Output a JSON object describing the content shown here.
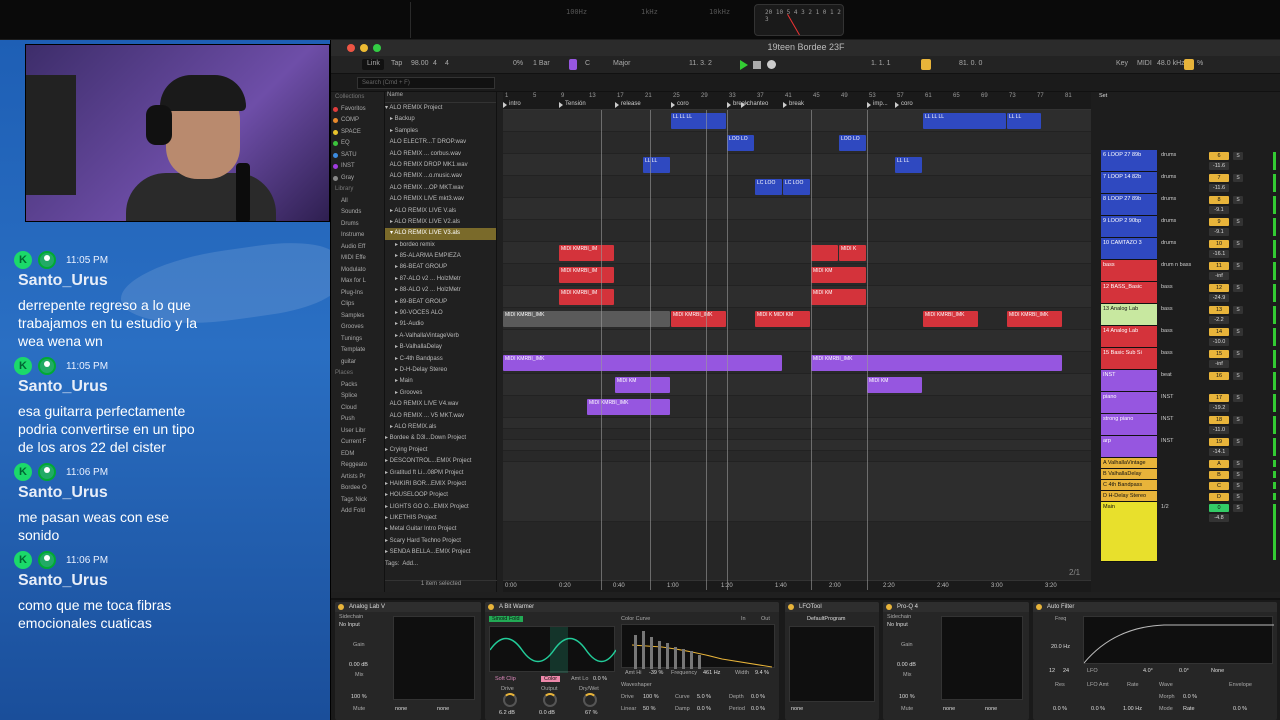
{
  "top": {
    "spectrum_labels": [
      "100Hz",
      "1kHz",
      "10kHz"
    ],
    "vu_scale": "20 10 5 4 3 2 1 0 1 2 3"
  },
  "stream": {
    "messages": [
      {
        "time": "11:05 PM",
        "user": "Santo_Urus",
        "text": "derrepente regreso a lo que trabajamos en tu estudio y la wea wena wn"
      },
      {
        "time": "11:05 PM",
        "user": "Santo_Urus",
        "text": "esa guitarra perfectamente podria convertirse en un tipo de los aros 22 del cister"
      },
      {
        "time": "11:06 PM",
        "user": "Santo_Urus",
        "text": "me pasan weas con ese sonido"
      },
      {
        "time": "11:06 PM",
        "user": "Santo_Urus",
        "text": "como que me toca fibras emocionales cuaticas"
      }
    ]
  },
  "ableton": {
    "title": "19teen Bordee 23F",
    "transport": {
      "link": "Link",
      "tap": "Tap",
      "bpm": "98.00",
      "sig_num": "4",
      "sig_den": "4",
      "cpu": "0%",
      "quant": "1 Bar",
      "key": "C",
      "scale": "Major",
      "position": "11.   3.   2",
      "loop_start": "1.   1.   1",
      "loop_len": "81.   0.   0",
      "key_btn": "Key",
      "midi_btn": "MIDI",
      "sample_rate": "48.0 kHz",
      "zoom": "%"
    },
    "search_placeholder": "Search (Cmd + F)",
    "browser": {
      "categories": [
        {
          "label": "Collections",
          "header": true
        },
        {
          "label": "Favoritos",
          "color": "#e03c3c"
        },
        {
          "label": "COMP",
          "color": "#e88a2c"
        },
        {
          "label": "SPACE",
          "color": "#e8c42c"
        },
        {
          "label": "EQ",
          "color": "#3cc43c"
        },
        {
          "label": "SATU",
          "color": "#3c8ce0"
        },
        {
          "label": "INST",
          "color": "#a03ce0"
        },
        {
          "label": "Gray",
          "color": "#888888"
        },
        {
          "label": "Library",
          "header": true
        },
        {
          "label": "All"
        },
        {
          "label": "Sounds"
        },
        {
          "label": "Drums"
        },
        {
          "label": "Instrume"
        },
        {
          "label": "Audio Eff"
        },
        {
          "label": "MIDI Effe"
        },
        {
          "label": "Modulato"
        },
        {
          "label": "Max for L"
        },
        {
          "label": "Plug-Ins"
        },
        {
          "label": "Clips"
        },
        {
          "label": "Samples"
        },
        {
          "label": "Grooves"
        },
        {
          "label": "Tunings"
        },
        {
          "label": "Template"
        },
        {
          "label": "guitar"
        },
        {
          "label": "Places",
          "header": true
        },
        {
          "label": "Packs"
        },
        {
          "label": "Splice"
        },
        {
          "label": "Cloud"
        },
        {
          "label": "Push"
        },
        {
          "label": "User Libr"
        },
        {
          "label": "Current F"
        },
        {
          "label": "EDM"
        },
        {
          "label": "Reggeato"
        },
        {
          "label": "Artists Pr"
        },
        {
          "label": "Bordee O"
        },
        {
          "label": "Tags Nick"
        },
        {
          "label": "Add Fold"
        }
      ],
      "files_header": "Name",
      "files": [
        "▾ ALO REMIX Project",
        "   ▸ Backup",
        "   ▸ Samples",
        "   ALO ELECTR...T DROP.wav",
        "   ALO REMIX ... corbus.wav",
        "   ALO REMIX DROP MK1.wav",
        "   ALO REMIX ...o.music.wav",
        "   ALO REMIX ...OP MKT.wav",
        "   ALO REMIX LIVE mkt3.wav",
        "   ▸ ALO REMIX LIVE V.als",
        "   ▸ ALO REMIX LIVE V2.als",
        "   ▾ ALO REMIX LIVE V3.als",
        "      ▸ bordeo remix",
        "      ▸ 85-ALARMA EMPIEZA",
        "      ▸ 86-BEAT GROUP",
        "      ▸ 87-ALO v2 ... HolzMetr",
        "      ▸ 88-ALO v2 ... HolzMetr",
        "      ▸ 89-BEAT GROUP",
        "      ▸ 90-VOCES ALO",
        "      ▸ 91-Audio",
        "      ▸ A-ValhallaVintageVerb",
        "      ▸ B-ValhallaDelay",
        "      ▸ C-4th Bandpass",
        "      ▸ D-H-Delay Stereo",
        "      ▸ Main",
        "      ▸ Grooves",
        "   ALO REMIX LIVE V4.wav",
        "   ALO REMIX ... V5 MKT.wav",
        "   ▸ ALO REMIX.als",
        "▸ Bordee & D3l...Down Project",
        "▸ Crying Project",
        "▸ DESCONTROL...EMIX Project",
        "▸ Gratitud ft Li...08PM Project",
        "▸ HAIKIRI BOR...EMIX Project",
        "▸ HOUSELOOP Project",
        "▸ LIGHTS GO O...EMIX Project",
        "▸ LIKETHIS Project",
        "▸ Metal Guitar Intro Project",
        "▸ Scary Hard Techno Project",
        "▸ SENDA BELLA...EMIX Project",
        "Tags:  Add..."
      ],
      "footer": "1 item selected"
    },
    "bar_numbers": [
      "1",
      "5",
      "9",
      "13",
      "17",
      "21",
      "25",
      "29",
      "33",
      "37",
      "41",
      "45",
      "49",
      "53",
      "57",
      "61",
      "65",
      "69",
      "73",
      "77",
      "81",
      "85"
    ],
    "locators": [
      {
        "label": "intro",
        "bar": 1
      },
      {
        "label": "Tensión",
        "bar": 9
      },
      {
        "label": "release",
        "bar": 17
      },
      {
        "label": "coro",
        "bar": 25
      },
      {
        "label": "break",
        "bar": 33
      },
      {
        "label": "chanteo",
        "bar": 35
      },
      {
        "label": "break",
        "bar": 41
      },
      {
        "label": "imp...",
        "bar": 53
      },
      {
        "label": "coro",
        "bar": 57
      }
    ],
    "time_ruler": [
      "0:00",
      "0:20",
      "0:40",
      "1:00",
      "1:20",
      "1:40",
      "2:00",
      "2:20",
      "2:40",
      "3:00",
      "3:20"
    ],
    "page_indicator": "2/1",
    "zoom_label": "0.00x",
    "tracks": [
      {
        "name": "6 LOOP 27 89b",
        "group": "drums",
        "num": "6",
        "vol": "-11.6",
        "color": "#2f49c0"
      },
      {
        "name": "7 LOOP 14 82b",
        "group": "drums",
        "num": "7",
        "vol": "-11.6",
        "color": "#2f49c0"
      },
      {
        "name": "8 LOOP 27 89b",
        "group": "drums",
        "num": "8",
        "vol": "-9.1",
        "color": "#2f49c0"
      },
      {
        "name": "9 LOOP 2 90bp",
        "group": "drums",
        "num": "9",
        "vol": "-9.1",
        "color": "#2f49c0"
      },
      {
        "name": "10 CAMTAZO 3",
        "group": "drums",
        "num": "10",
        "vol": "-16.1",
        "color": "#2f49c0"
      },
      {
        "name": "bass",
        "group": "drum n bass",
        "num": "11",
        "vol": "-inf",
        "color": "#d4333b"
      },
      {
        "name": "12 BASS_Basic",
        "group": "bass",
        "num": "12",
        "vol": "-24.9",
        "color": "#d4333b"
      },
      {
        "name": "13 Analog Lab",
        "group": "bass",
        "num": "13",
        "vol": "-2.2",
        "color": "#c8e8a0"
      },
      {
        "name": "14 Analog Lab",
        "group": "bass",
        "num": "14",
        "vol": "-10.0",
        "color": "#d4333b"
      },
      {
        "name": "15 Basic Sub Si",
        "group": "bass",
        "num": "15",
        "vol": "-inf",
        "color": "#d4333b"
      },
      {
        "name": "INST",
        "group": "beat",
        "num": "16",
        "vol": "",
        "color": "#9656e0"
      },
      {
        "name": "piano",
        "group": "INST",
        "num": "17",
        "vol": "-19.2",
        "color": "#9656e0"
      },
      {
        "name": "strong piano",
        "group": "INST",
        "num": "18",
        "vol": "-11.0",
        "color": "#9656e0"
      },
      {
        "name": "arp",
        "group": "INST",
        "num": "19",
        "vol": "-14.1",
        "color": "#9656e0"
      },
      {
        "name": "A ValhallaVintage",
        "group": "",
        "num": "A",
        "vol": "",
        "color": "#e8b43a"
      },
      {
        "name": "B ValhallaDelay",
        "group": "",
        "num": "B",
        "vol": "",
        "color": "#e8b43a"
      },
      {
        "name": "C 4th Bandpass",
        "group": "",
        "num": "C",
        "vol": "",
        "color": "#e8b43a"
      },
      {
        "name": "D H-Delay Stereo",
        "group": "",
        "num": "D",
        "vol": "",
        "color": "#e8b43a"
      },
      {
        "name": "Main",
        "group": "1/2",
        "num": "0",
        "vol": "-4.8",
        "color": "#e8e02c"
      }
    ],
    "mixer_header": "Set",
    "devices": {
      "analog_lab": {
        "title": "Analog Lab V",
        "sidechain": "Sidechain",
        "input": "No Input",
        "gain": "Gain",
        "gain_val": "0.00 dB",
        "mix": "Mix",
        "mix_val": "100 %",
        "mute": "Mute",
        "none1": "none",
        "none2": "none"
      },
      "bitwarmer": {
        "title": "A Bit Warmer",
        "mode": "Sinoid Fold",
        "soft_clip": "Soft Clip",
        "color": "Color",
        "amt_lo": "Amt Lo",
        "amt_lo_val": "0.0 %",
        "drive": "Drive",
        "drive_val": "6.2 dB",
        "output": "Output",
        "output_val": "0.0 dB",
        "drywet": "Dry/Wet",
        "drywet_val": "67 %"
      },
      "color_curve": {
        "title": "Color Curve",
        "in": "In",
        "out": "Out",
        "amt_hi": "Amt Hi",
        "amt_hi_val": "-39 %",
        "freq": "Frequency",
        "freq_val": "461 Hz",
        "width": "Width",
        "width_val": "9.4 %",
        "waveshaper": "Waveshaper",
        "drive": "Drive",
        "drive_val": "100 %",
        "curve": "Curve",
        "curve_val": "5.0 %",
        "depth": "Depth",
        "depth_val": "0.0 %",
        "linear": "Linear",
        "linear_val": "50 %",
        "damp": "Damp",
        "damp_val": "0.0 %",
        "period": "Period",
        "period_val": "0.0 %"
      },
      "lfotool": {
        "title": "LFOTool",
        "program": "DefaultProgram",
        "none": "none"
      },
      "proq4": {
        "title": "Pro-Q 4",
        "sidechain": "Sidechain",
        "input": "No Input",
        "gain": "Gain",
        "gain_val": "0.00 dB",
        "mix": "Mix",
        "mix_val": "100 %",
        "mute": "Mute",
        "none1": "none",
        "none2": "none"
      },
      "autofilter": {
        "title": "Auto Filter",
        "freq": "Freq",
        "freq_val": "20.0 Hz",
        "lfo": "LFO",
        "lfo_val1": "4.0°",
        "lfo_val2": "0.0°",
        "none": "None",
        "res": "Res",
        "res_val": "0.0 %",
        "lfo_amt": "LFO Amt",
        "lfo_amt_val": "0.0 %",
        "rate": "Rate",
        "rate_val": "1.00 Hz",
        "wave": "Wave",
        "morph": "Morph",
        "morph_val": "0.0 %",
        "mode": "Mode",
        "mode_val": "Rate",
        "envelope": "Envelope",
        "envelope_val": "0.0 %",
        "slope": "12",
        "slope2": "24"
      }
    }
  }
}
